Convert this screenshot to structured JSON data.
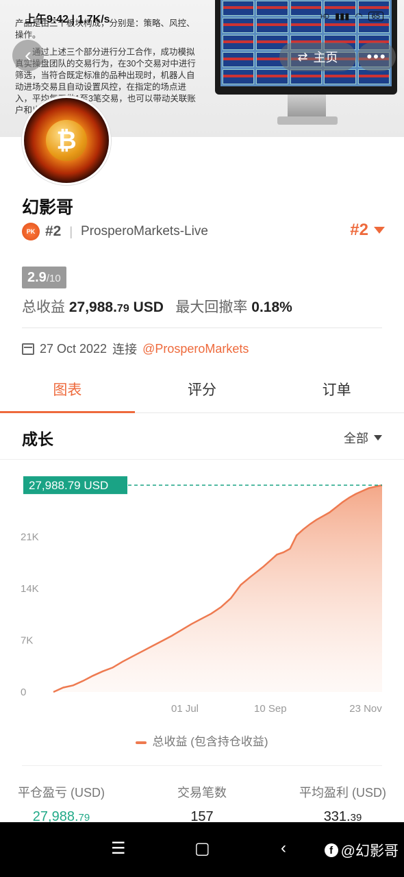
{
  "status_bar": {
    "time": "上午9:42",
    "speed": "1.7K/s",
    "battery": "65"
  },
  "background_doc": {
    "paragraph1": "产品是由三个板块构成，分别是：策略、风控、操作。",
    "paragraph2": "通过上述三个部分进行分工合作，成功模拟真实操盘团队的交易行为，在30个交易对中进行筛选，当符合既定标准的品种出现时，机器人自动进场交易且自动设置风控，在指定的场点进入，平均每天做1至3笔交易，也可以带动关联账户和出场！"
  },
  "header": {
    "home_label": "主页",
    "more_label": "•••"
  },
  "profile": {
    "name": "幻影哥",
    "rank_small": "#2",
    "broker": "ProsperoMarkets-Live",
    "rank_big": "#2",
    "score": "2.9",
    "score_max": "/10",
    "total_profit_label": "总收益",
    "total_profit_int": "27,988.",
    "total_profit_dec": "79",
    "total_profit_unit": "USD",
    "max_drawdown_label": "最大回撤率",
    "max_drawdown": "0.18%",
    "connect_date": "27 Oct 2022",
    "connect_label": "连接",
    "connect_handle": "@ProsperoMarkets"
  },
  "tabs": [
    {
      "label": "图表",
      "active": true
    },
    {
      "label": "评分"
    },
    {
      "label": "订单"
    }
  ],
  "growth": {
    "title": "成长",
    "filter": "全部"
  },
  "chart_data": {
    "type": "area",
    "current_label": "27,988.79 USD",
    "y_ticks": [
      "21K",
      "14K",
      "7K",
      "0"
    ],
    "y_tick_values": [
      21000,
      14000,
      7000,
      0
    ],
    "x_ticks": [
      "01 Jul",
      "10 Sep",
      "23 Nov"
    ],
    "x_tick_positions": [
      0.4,
      0.66,
      0.95
    ],
    "ylim": [
      0,
      28000
    ],
    "series": [
      {
        "name": "总收益 (包含持仓收益)",
        "x": [
          0,
          0.03,
          0.06,
          0.09,
          0.12,
          0.15,
          0.18,
          0.21,
          0.24,
          0.27,
          0.3,
          0.33,
          0.36,
          0.39,
          0.42,
          0.45,
          0.48,
          0.51,
          0.54,
          0.57,
          0.6,
          0.62,
          0.64,
          0.66,
          0.68,
          0.7,
          0.72,
          0.74,
          0.76,
          0.78,
          0.8,
          0.82,
          0.84,
          0.86,
          0.88,
          0.9,
          0.92,
          0.94,
          0.96,
          0.98,
          1.0
        ],
        "values": [
          0,
          600,
          900,
          1500,
          2200,
          2800,
          3300,
          4100,
          4800,
          5500,
          6200,
          6900,
          7600,
          8400,
          9200,
          9900,
          10600,
          11500,
          12700,
          14500,
          15600,
          16300,
          17000,
          17800,
          18600,
          18900,
          19400,
          21200,
          22000,
          22700,
          23300,
          23800,
          24300,
          25000,
          25700,
          26300,
          26800,
          27200,
          27600,
          27800,
          27988.79
        ],
        "color": "#ee7a50"
      }
    ],
    "legend": "总收益 (包含持仓收益)"
  },
  "bottom_stats": [
    {
      "label": "平仓盈亏 (USD)",
      "value_int": "27,988.",
      "value_dec": "79",
      "color": "green"
    },
    {
      "label": "交易笔数",
      "value_int": "157",
      "value_dec": ""
    },
    {
      "label": "平均盈利 (USD)",
      "value_int": "331.",
      "value_dec": "39"
    }
  ],
  "watermark": "@幻影哥"
}
